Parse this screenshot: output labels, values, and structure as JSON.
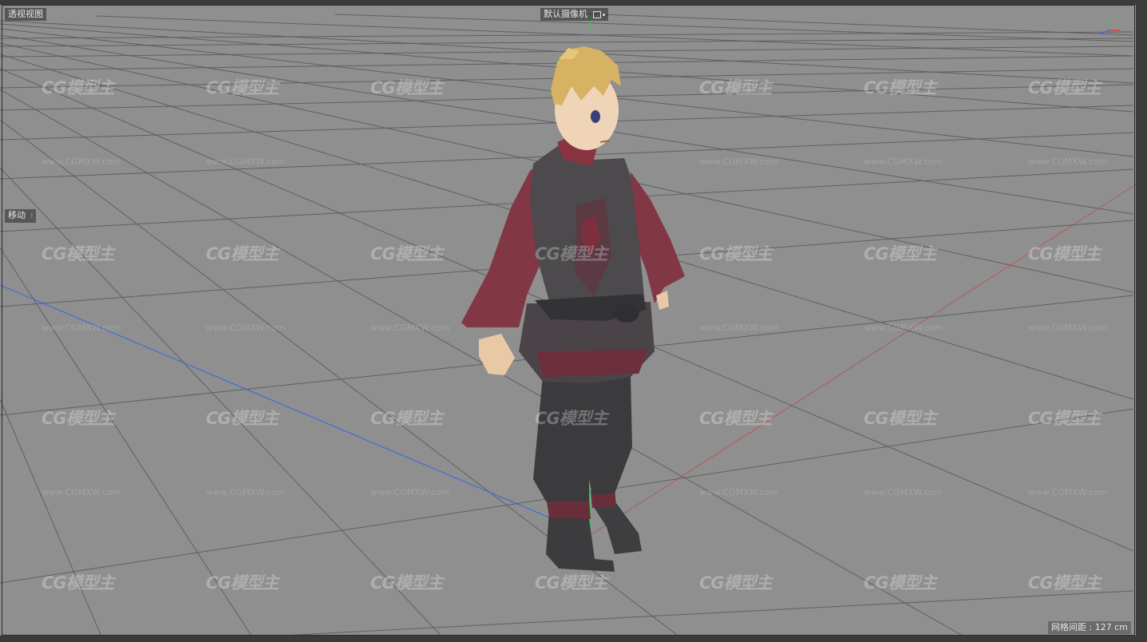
{
  "viewport": {
    "view_name": "透视视图",
    "camera_name": "默认摄像机",
    "camera_icon": "camera-frame-icon",
    "tool_name": "移动",
    "grid_spacing": "网格间距 : 127 cm"
  },
  "watermark": {
    "logo_text": "CG模型主",
    "url_text": "www.CGMXW.com"
  },
  "colors": {
    "background": "#8f8f8f",
    "grid_line": "#555555",
    "x_axis": "#c04040",
    "z_axis": "#3c6fd6",
    "y_axis": "#3fbf6a"
  }
}
